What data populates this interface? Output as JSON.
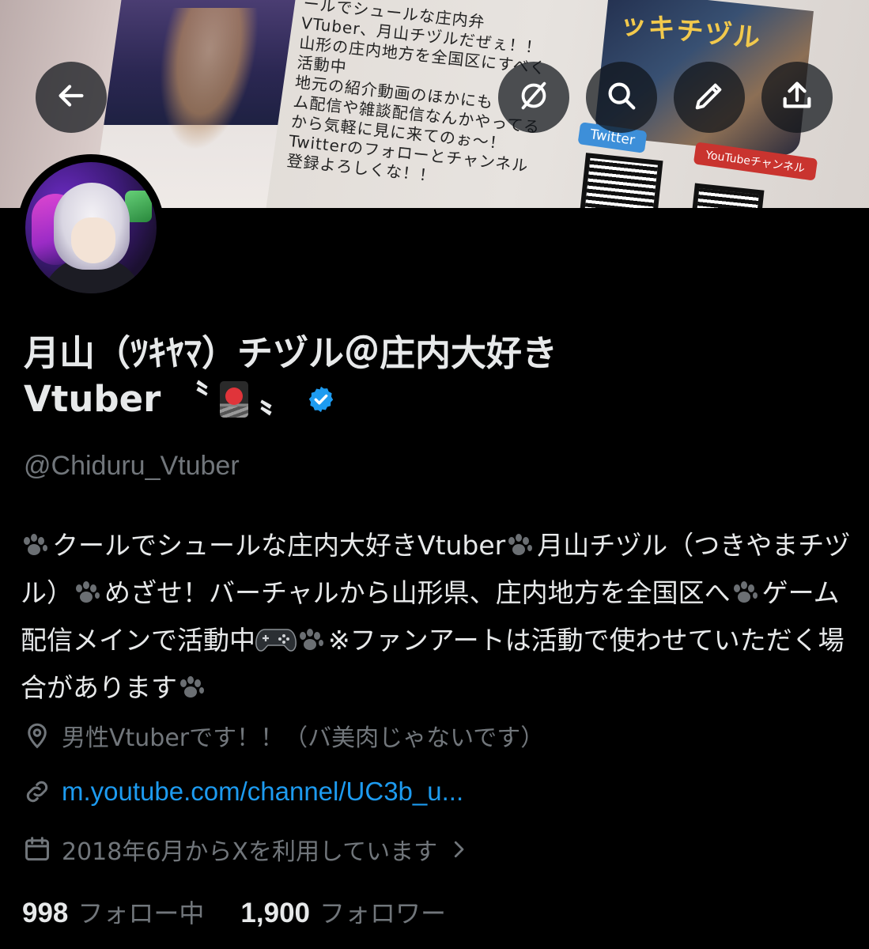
{
  "banner": {
    "text_lines": [
      "ールでシュールな庄内弁",
      "VTuber、月山チヅルだぜぇ！！",
      "山形の庄内地方を全国区にすべく",
      "活動中",
      "地元の紹介動画のほかにも",
      "ム配信や雑談配信なんかやってる",
      "から気軽に見に来てのぉ～！",
      "Twitterのフォローとチャンネル",
      "登録よろしくな！！"
    ],
    "art_brand": "ッキチヅル",
    "twitter_chip": "Twitter",
    "youtube_chip": "YouTubeチャンネル",
    "buttons": {
      "back_icon": "back-arrow-icon",
      "grok_icon": "grok-icon",
      "search_icon": "search-icon",
      "edit_icon": "pencil-icon",
      "share_icon": "share-icon"
    }
  },
  "profile": {
    "name_line1": "月山（ﾂｷﾔﾏ）チヅル＠庄内大好き",
    "name_line2_prefix": "Vtuber 〝",
    "name_line2_suffix": "〟",
    "handle": "@Chiduru_Vtuber",
    "verified_color": "#1d9bf0",
    "bio": {
      "seg1": "クールでシュールな庄内大好きVtuber",
      "seg2": "月山チヅル（つきやまチヅル）",
      "seg3": "めざせ！バーチャルから山形県、庄内地方を全国区へ",
      "seg4": "ゲーム配信メインで活動中",
      "seg5": "※ファンアートは活動で使わせていただく場合があります"
    },
    "location": "男性Vtuberです！！（バ美肉じゃないです）",
    "link": "m.youtube.com/channel/UC3b_u...",
    "joined": "2018年6月からXを利用しています",
    "following_count": "998",
    "following_label": "フォロー中",
    "followers_count": "1,900",
    "followers_label": "フォロワー"
  },
  "colors": {
    "background": "#000000",
    "primary_text": "#e7e9ea",
    "secondary_text": "#71767b",
    "link": "#1d9bf0"
  }
}
